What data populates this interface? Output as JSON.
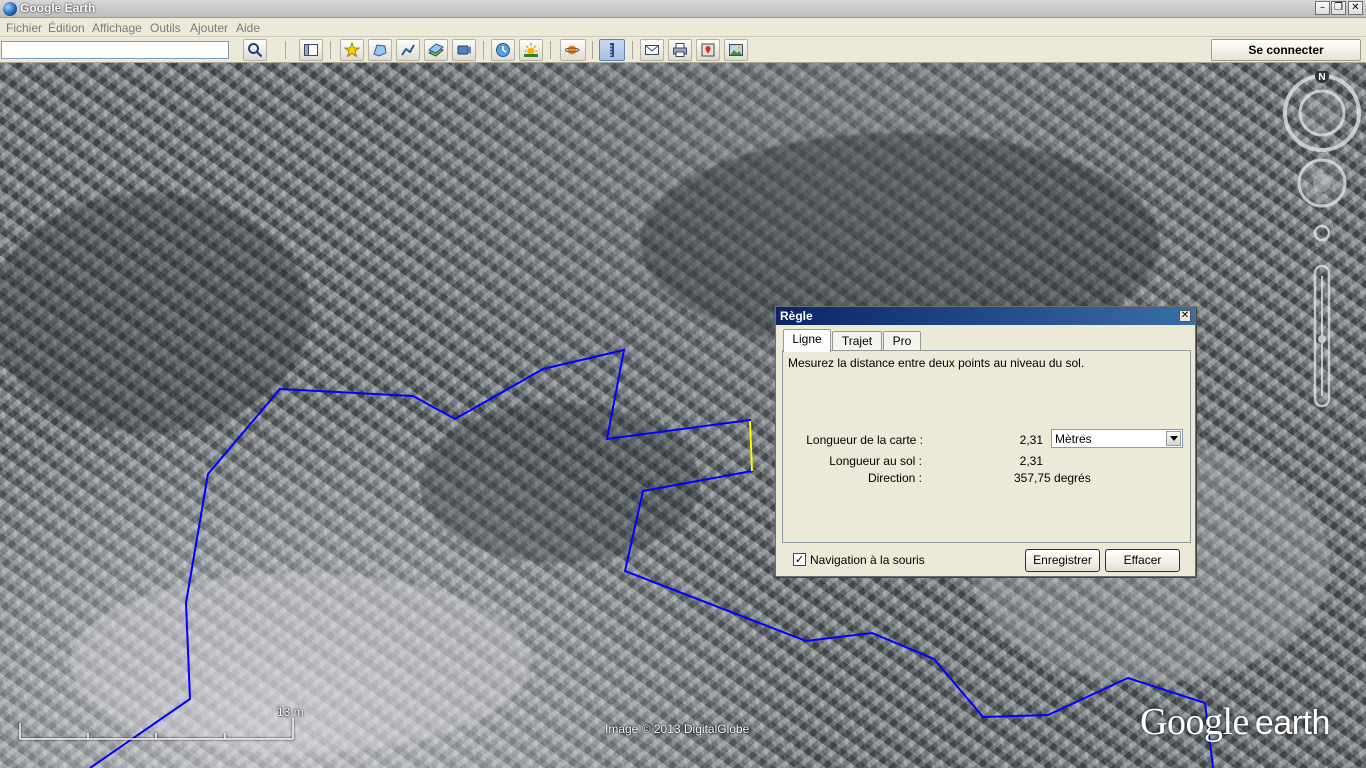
{
  "window": {
    "title": "Google Earth"
  },
  "menu": {
    "items": [
      "Fichier",
      "Édition",
      "Affichage",
      "Outils",
      "Ajouter",
      "Aide"
    ]
  },
  "toolbar": {
    "search_value": "",
    "signin_label": "Se connecter",
    "icons": [
      "search-icon",
      "sidebar-icon",
      "placemark-icon",
      "polygon-icon",
      "path-icon",
      "overlay-icon",
      "tour-icon",
      "history-icon",
      "sun-icon",
      "planets-icon",
      "ruler-icon",
      "email-icon",
      "print-icon",
      "maps-icon",
      "image-icon"
    ]
  },
  "map": {
    "scale_label": "13 m",
    "credit": "Image © 2013 DigitalGlobe",
    "logo_google": "Google",
    "logo_earth": "earth",
    "compass_north": "N",
    "colors": {
      "path_line": "#0000ff",
      "ruler_line": "#ffff00"
    }
  },
  "ruler_dialog": {
    "title": "Règle",
    "tabs": [
      "Ligne",
      "Trajet",
      "Pro"
    ],
    "active_tab": "Ligne",
    "description": "Mesurez la distance entre deux points au niveau du sol.",
    "map_length_label": "Longueur de la carte :",
    "map_length_value": "2,31",
    "unit": "Mètres",
    "ground_length_label": "Longueur au sol :",
    "ground_length_value": "2,31",
    "direction_label": "Direction :",
    "direction_value": "357,75 degrés",
    "mouse_nav_label": "Navigation à la souris",
    "mouse_nav_checked": true,
    "save_label": "Enregistrer",
    "clear_label": "Effacer"
  }
}
